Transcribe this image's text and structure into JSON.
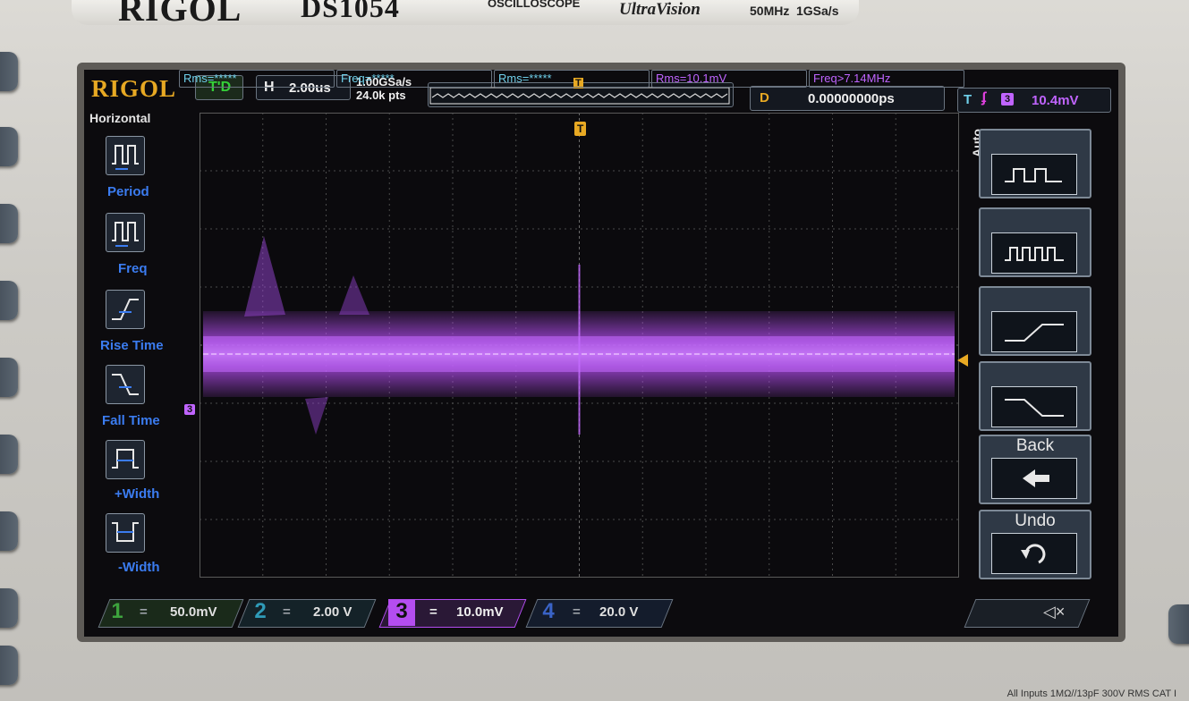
{
  "device": {
    "brand": "RIGOL",
    "model": "DS1054",
    "type": "OSCILLOSCOPE",
    "series": "UltraVision",
    "bandwidth": "50MHz",
    "sample_rate_spec": "1GSa/s",
    "input_spec": "All Inputs 1MΩ//13pF 300V RMS  CAT I"
  },
  "header": {
    "logo": "RIGOL",
    "trigger_status": "T'D",
    "horizontal_label": "H",
    "timebase": "2.00us",
    "sample_rate": "1.00GSa/s",
    "memory_depth": "24.0k pts",
    "delay_label": "D",
    "delay_value": "0.00000000ps",
    "trigger_label": "T",
    "trigger_source": "3",
    "trigger_level": "10.4mV"
  },
  "left_menu": {
    "title": "Horizontal",
    "items": [
      {
        "label": "Period"
      },
      {
        "label": "Freq"
      },
      {
        "label": "Rise Time"
      },
      {
        "label": "Fall Time"
      },
      {
        "label": "+Width"
      },
      {
        "label": "-Width"
      }
    ]
  },
  "right_menu": {
    "mode_label": "Auto",
    "back_label": "Back",
    "undo_label": "Undo"
  },
  "markers": {
    "trigger_top": "T",
    "channel_marker": "3"
  },
  "measurements": [
    {
      "text": "Rms=*****"
    },
    {
      "text": "Freq=*****"
    },
    {
      "text": "Rms=*****"
    },
    {
      "text": "Rms=10.1mV"
    },
    {
      "text": "Freq>7.14MHz"
    }
  ],
  "channels": [
    {
      "num": "1",
      "coupling": "=",
      "scale": "50.0mV",
      "color": "#3da33d"
    },
    {
      "num": "2",
      "coupling": "=",
      "scale": "2.00 V",
      "color": "#2f9bb8"
    },
    {
      "num": "3",
      "coupling": "=",
      "scale": "10.0mV",
      "color": "#b44df0"
    },
    {
      "num": "4",
      "coupling": "=",
      "scale": "20.0 V",
      "color": "#3a63c6"
    }
  ],
  "colors": {
    "trace": "#b44df0",
    "trigger": "#e8a923",
    "timebase_text": "#f0f0f0",
    "trigger_status": "#34d038"
  }
}
